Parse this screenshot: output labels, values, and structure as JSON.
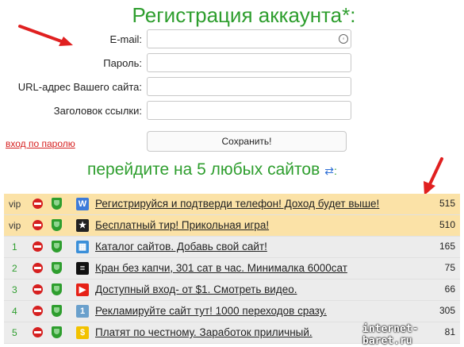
{
  "title": "Регистрация аккаунта*:",
  "form": {
    "email_label": "E-mail:",
    "email_value": "",
    "password_label": "Пароль:",
    "password_value": "",
    "url_label": "URL-адрес Вашего сайта:",
    "url_value": "",
    "link_title_label": "Заголовок ссылки:",
    "link_title_value": "",
    "login_link": "вход по паролю",
    "save_button": "Сохранить!"
  },
  "subtitle": "перейдите на 5 любых сайтов",
  "subtitle_suffix": ":",
  "sites": [
    {
      "tag": "vip",
      "favicon": "W",
      "favicon_color": "#3d7bd9",
      "text": "Регистрируйся и подтверди телефон! Доход будет выше!",
      "count": "515"
    },
    {
      "tag": "vip",
      "favicon": "★",
      "favicon_color": "#222222",
      "text": "Бесплатный тир! Прикольная игра!",
      "count": "510"
    },
    {
      "tag": "1",
      "favicon": "▦",
      "favicon_color": "#3a8fd9",
      "text": "Каталог сайтов. Добавь свой сайт!",
      "count": "165"
    },
    {
      "tag": "2",
      "favicon": "≡",
      "favicon_color": "#111111",
      "text": "Кран без капчи, 301 сат в час. Минималка 6000сат",
      "count": "75"
    },
    {
      "tag": "3",
      "favicon": "▶",
      "favicon_color": "#e62117",
      "text": "Доступный вход- от $1. Смотреть видео.",
      "count": "66"
    },
    {
      "tag": "4",
      "favicon": "1",
      "favicon_color": "#6aa0cc",
      "text": "Рекламируйте сайт тут! 1000 переходов сразу.",
      "count": "305"
    },
    {
      "tag": "5",
      "favicon": "$",
      "favicon_color": "#f2c200",
      "text": "Платят по честному. Заработок приличный.",
      "count": "81"
    }
  ],
  "watermark": "internet-baret.ru",
  "colors": {
    "accent_green": "#2e9e2e",
    "vip_bg": "#fbe2a7",
    "row_bg": "#ececec",
    "arrow_red": "#e02020",
    "link_red": "#d62020"
  }
}
